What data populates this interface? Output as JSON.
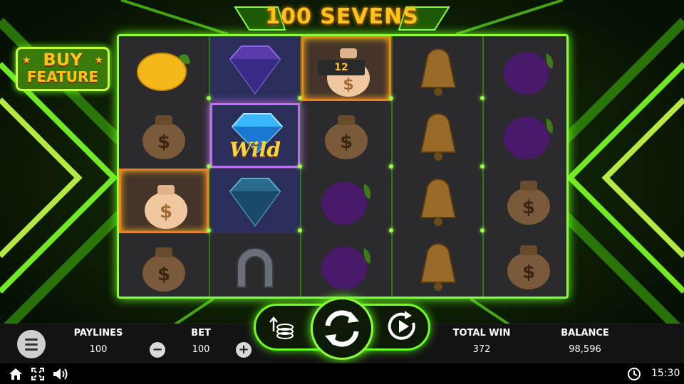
{
  "game": {
    "title": "100 SEVENS",
    "buy_feature_line1": "BUY",
    "buy_feature_line2": "FEATURE"
  },
  "reels": [
    [
      "lemon",
      "money-bag",
      "money-bag-highlighted",
      "money-bag"
    ],
    [
      "diamond",
      "wild-diamond",
      "diamond",
      "horseshoe"
    ],
    [
      "money-bag-highlighted",
      "money-bag",
      "plum",
      "plum"
    ],
    [
      "bell",
      "bell",
      "bell",
      "bell"
    ],
    [
      "plum",
      "plum",
      "money-bag",
      "money-bag"
    ]
  ],
  "wild_label": "Wild",
  "win_badge": "12",
  "panel": {
    "paylines_label": "PAYLINES",
    "paylines_value": "100",
    "bet_label": "BET",
    "bet_value": "100",
    "minus": "−",
    "plus": "+",
    "total_win_label": "TOTAL WIN",
    "total_win_value": "372",
    "balance_label": "BALANCE",
    "balance_value": "98,596"
  },
  "status": {
    "time": "15:30",
    "icons": [
      "home-icon",
      "fullscreen-icon",
      "sound-icon",
      "clock-icon"
    ]
  },
  "colors": {
    "neon": "#8bff3a",
    "gold": "#ffc21a",
    "highlight": "#ff7a1a"
  }
}
